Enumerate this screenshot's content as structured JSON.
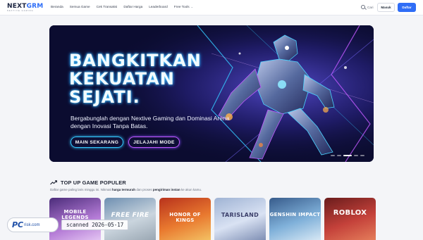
{
  "brand": {
    "name_part1": "NEXT",
    "name_part2": "GRM",
    "tagline": "NEXTIVE GAMING"
  },
  "nav": {
    "items": [
      "Beranda",
      "Semua Game",
      "Cek Transaksi",
      "Daftar Harga",
      "Leaderboard",
      "Free Tools"
    ],
    "search_label": "Cari",
    "login_label": "Masuk",
    "register_label": "Daftar"
  },
  "hero": {
    "headline_1": "BANGKITKAN",
    "headline_2": "KEKUATAN",
    "headline_3": "SEJATI.",
    "subtitle": "Bergabunglah dengan Nextive Gaming dan Dominasi Arena dengan Inovasi Tanpa Batas.",
    "cta_primary": "MAIN SEKARANG",
    "cta_secondary": "JELAJAHI MODE",
    "slides_total": 5,
    "slide_active": 3
  },
  "section": {
    "title": "TOP UP GAME POPULER",
    "desc_1": "Daftar game paling laris minggu ini. Nikmati ",
    "desc_bold_1": "harga termurah",
    "desc_2": " dan proses ",
    "desc_bold_2": "pengiriman instan",
    "desc_3": " ke akun kamu."
  },
  "games": [
    {
      "title": "MOBILE LEGENDS"
    },
    {
      "title": "FREE FIRE"
    },
    {
      "title": "HONOR OF KINGS"
    },
    {
      "title": "TARISLAND"
    },
    {
      "title": "GENSHIN IMPACT"
    },
    {
      "title": "ROBLOX"
    }
  ],
  "watermark": {
    "logo_pc": "PC",
    "logo_risk": "risk.com",
    "stamp": "scanned 2026-05-17"
  },
  "colors": {
    "accent": "#2f6df6",
    "hero_bg": "#0a0b2a",
    "neon_cyan": "#34c8ff",
    "neon_purple": "#c259ff"
  }
}
